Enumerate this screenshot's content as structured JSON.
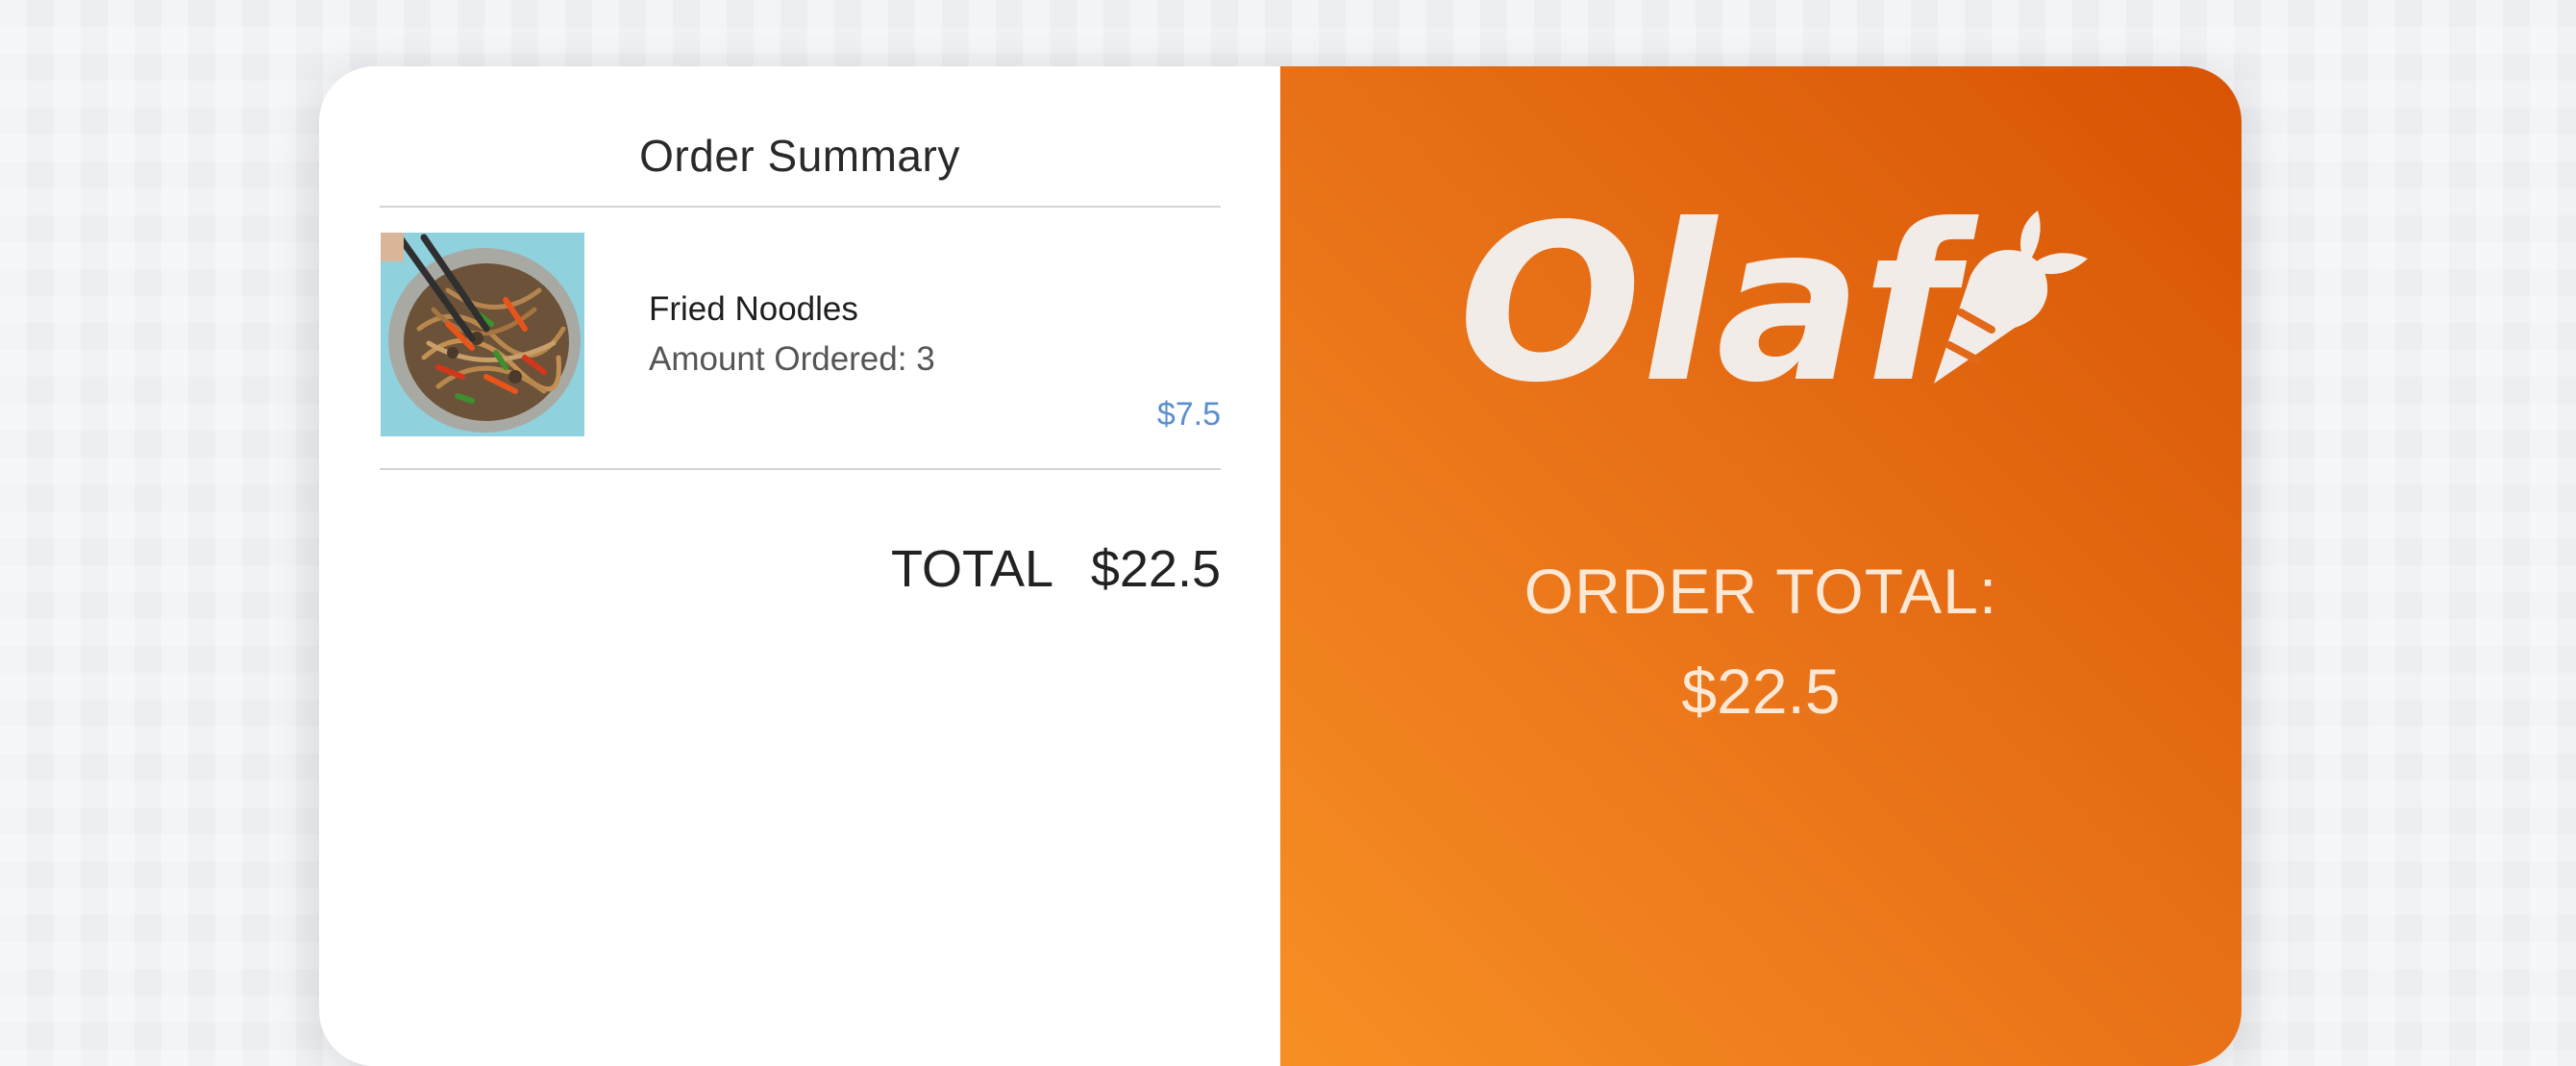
{
  "summary": {
    "title": "Order Summary",
    "items": [
      {
        "name": "Fried Noodles",
        "amount_label": "Amount Ordered:",
        "amount": "3",
        "price": "$7.5",
        "image": "fried-noodles-photo"
      }
    ],
    "total_label": "TOTAL",
    "total_value": "$22.5"
  },
  "brand": {
    "logo_text": "Olaf",
    "logo_icon": "carrot-icon",
    "logo_color": "#f1ece8",
    "accent_gradient": [
      "#f78f23",
      "#d75404"
    ]
  },
  "order_panel": {
    "label": "ORDER TOTAL:",
    "value": "$22.5"
  },
  "colors": {
    "price": "#5a8fd0",
    "text": "#222222",
    "divider": "#d3d3d3"
  }
}
